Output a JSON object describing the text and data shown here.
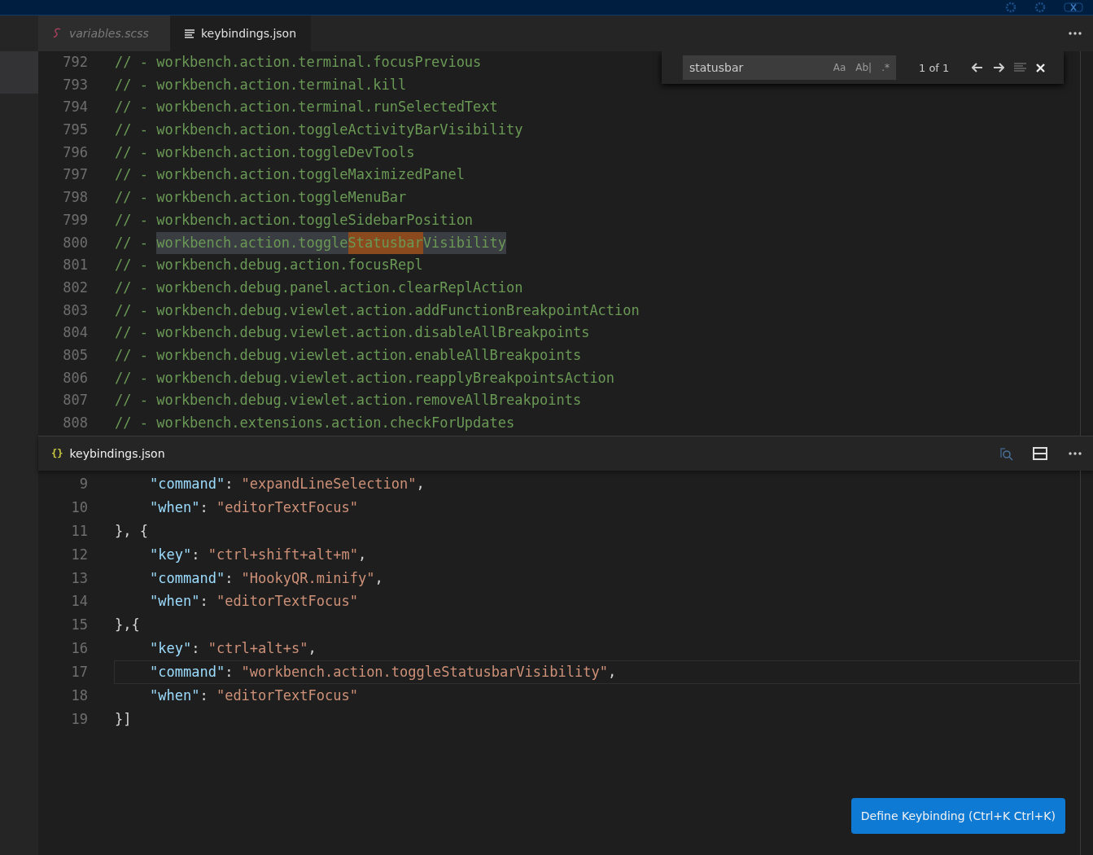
{
  "tabs": [
    {
      "label": "variables.scss",
      "kind": "scss",
      "selected": false,
      "preview": true
    },
    {
      "label": "keybindings.json",
      "kind": "json",
      "selected": true,
      "preview": false
    }
  ],
  "find_widget": {
    "value": "statusbar",
    "options": [
      {
        "label": "Aa",
        "on": false
      },
      {
        "label": "Ab|",
        "on": false
      },
      {
        "label": ".*",
        "on": false
      }
    ],
    "result": "1 of 1"
  },
  "top_editor": {
    "lines": [
      {
        "number": "792",
        "segments": [
          {
            "text": "// - workbench.action.terminal.focusPrevious",
            "kind": "plain"
          }
        ]
      },
      {
        "number": "793",
        "segments": [
          {
            "text": "// - workbench.action.terminal.kill",
            "kind": "plain"
          }
        ]
      },
      {
        "number": "794",
        "segments": [
          {
            "text": "// - workbench.action.terminal.runSelectedText",
            "kind": "plain"
          }
        ]
      },
      {
        "number": "795",
        "segments": [
          {
            "text": "// - workbench.action.toggleActivityBarVisibility",
            "kind": "plain"
          }
        ]
      },
      {
        "number": "796",
        "segments": [
          {
            "text": "// - workbench.action.toggleDevTools",
            "kind": "plain"
          }
        ]
      },
      {
        "number": "797",
        "segments": [
          {
            "text": "// - workbench.action.toggleMaximizedPanel",
            "kind": "plain"
          }
        ]
      },
      {
        "number": "798",
        "segments": [
          {
            "text": "// - workbench.action.toggleMenuBar",
            "kind": "plain"
          }
        ]
      },
      {
        "number": "799",
        "segments": [
          {
            "text": "// - workbench.action.toggleSidebarPosition",
            "kind": "plain"
          }
        ]
      },
      {
        "number": "800",
        "segments": [
          {
            "text": "// - ",
            "kind": "plain"
          },
          {
            "text": "workbench.action.toggle",
            "kind": "selection"
          },
          {
            "text": "Statusbar",
            "kind": "match"
          },
          {
            "text": "Visibility",
            "kind": "selection"
          }
        ]
      },
      {
        "number": "801",
        "segments": [
          {
            "text": "// - workbench.debug.action.focusRepl",
            "kind": "plain"
          }
        ]
      },
      {
        "number": "802",
        "segments": [
          {
            "text": "// - workbench.debug.panel.action.clearReplAction",
            "kind": "plain"
          }
        ]
      },
      {
        "number": "803",
        "segments": [
          {
            "text": "// - workbench.debug.viewlet.action.addFunctionBreakpointAction",
            "kind": "plain"
          }
        ]
      },
      {
        "number": "804",
        "segments": [
          {
            "text": "// - workbench.debug.viewlet.action.disableAllBreakpoints",
            "kind": "plain"
          }
        ]
      },
      {
        "number": "805",
        "segments": [
          {
            "text": "// - workbench.debug.viewlet.action.enableAllBreakpoints",
            "kind": "plain"
          }
        ]
      },
      {
        "number": "806",
        "segments": [
          {
            "text": "// - workbench.debug.viewlet.action.reapplyBreakpointsAction",
            "kind": "plain"
          }
        ]
      },
      {
        "number": "807",
        "segments": [
          {
            "text": "// - workbench.debug.viewlet.action.removeAllBreakpoints",
            "kind": "plain"
          }
        ]
      },
      {
        "number": "808",
        "segments": [
          {
            "text": "// - workbench.extensions.action.checkForUpdates",
            "kind": "plain"
          }
        ]
      }
    ]
  },
  "bottom_panel": {
    "icon": "{}",
    "title": "keybindings.json",
    "lines": [
      {
        "number": "9",
        "current": false,
        "indent": true,
        "segments": [
          {
            "text": "\"command\"",
            "kind": "key"
          },
          {
            "text": ": ",
            "kind": "punct"
          },
          {
            "text": "\"expandLineSelection\"",
            "kind": "string"
          },
          {
            "text": ",",
            "kind": "punct"
          }
        ]
      },
      {
        "number": "10",
        "current": false,
        "indent": true,
        "segments": [
          {
            "text": "\"when\"",
            "kind": "key"
          },
          {
            "text": ": ",
            "kind": "punct"
          },
          {
            "text": "\"editorTextFocus\"",
            "kind": "string"
          }
        ]
      },
      {
        "number": "11",
        "current": false,
        "indent": false,
        "segments": [
          {
            "text": "}, {",
            "kind": "punct"
          }
        ]
      },
      {
        "number": "12",
        "current": false,
        "indent": true,
        "segments": [
          {
            "text": "\"key\"",
            "kind": "key"
          },
          {
            "text": ": ",
            "kind": "punct"
          },
          {
            "text": "\"ctrl+shift+alt+m\"",
            "kind": "string"
          },
          {
            "text": ",",
            "kind": "punct"
          }
        ]
      },
      {
        "number": "13",
        "current": false,
        "indent": true,
        "segments": [
          {
            "text": "\"command\"",
            "kind": "key"
          },
          {
            "text": ": ",
            "kind": "punct"
          },
          {
            "text": "\"HookyQR.minify\"",
            "kind": "string"
          },
          {
            "text": ",",
            "kind": "punct"
          }
        ]
      },
      {
        "number": "14",
        "current": false,
        "indent": true,
        "segments": [
          {
            "text": "\"when\"",
            "kind": "key"
          },
          {
            "text": ": ",
            "kind": "punct"
          },
          {
            "text": "\"editorTextFocus\"",
            "kind": "string"
          }
        ]
      },
      {
        "number": "15",
        "current": false,
        "indent": false,
        "segments": [
          {
            "text": "},{",
            "kind": "punct"
          }
        ]
      },
      {
        "number": "16",
        "current": false,
        "indent": true,
        "segments": [
          {
            "text": "\"key\"",
            "kind": "key"
          },
          {
            "text": ": ",
            "kind": "punct"
          },
          {
            "text": "\"ctrl+alt+s\"",
            "kind": "string"
          },
          {
            "text": ",",
            "kind": "punct"
          }
        ]
      },
      {
        "number": "17",
        "current": true,
        "indent": true,
        "segments": [
          {
            "text": "\"command\"",
            "kind": "key"
          },
          {
            "text": ": ",
            "kind": "punct"
          },
          {
            "text": "\"workbench.action.toggleStatusbarVisibility\"",
            "kind": "string"
          },
          {
            "text": ",",
            "kind": "punct"
          }
        ]
      },
      {
        "number": "18",
        "current": false,
        "indent": true,
        "segments": [
          {
            "text": "\"when\"",
            "kind": "key"
          },
          {
            "text": ": ",
            "kind": "punct"
          },
          {
            "text": "\"editorTextFocus\"",
            "kind": "string"
          }
        ]
      },
      {
        "number": "19",
        "current": false,
        "indent": false,
        "segments": [
          {
            "text": "}]",
            "kind": "punct"
          }
        ]
      }
    ],
    "button": "Define Keybinding (Ctrl+K Ctrl+K)"
  }
}
